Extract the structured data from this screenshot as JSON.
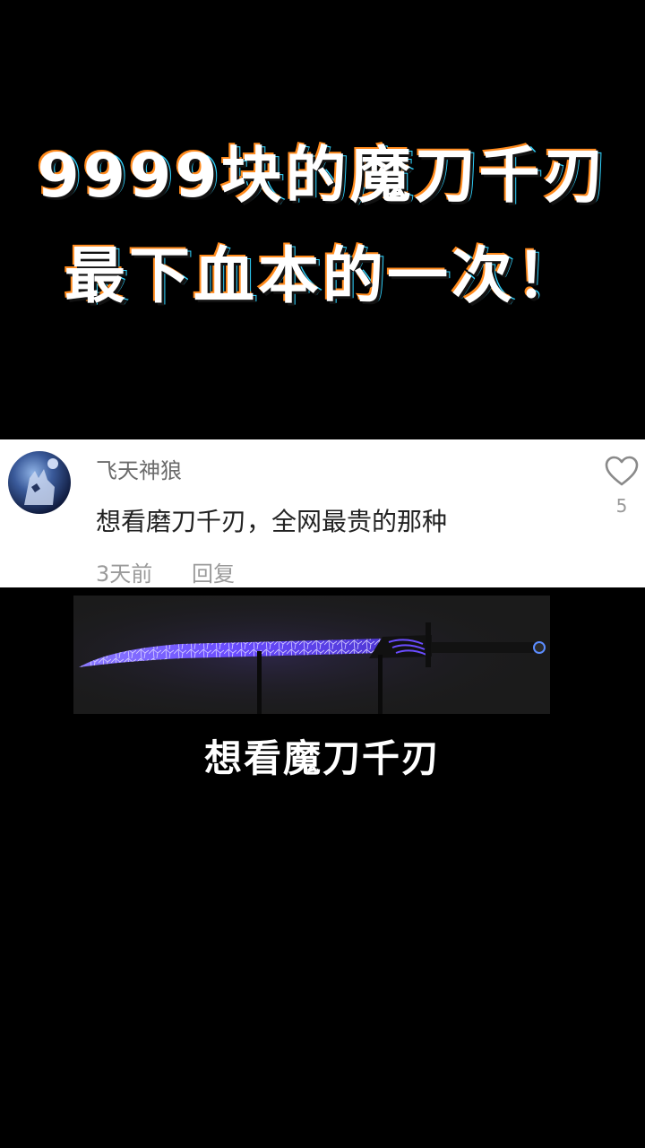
{
  "title": {
    "line1": "9999块的魔刀千刃",
    "line2": "最下血本的一次！"
  },
  "comment": {
    "username": "飞天神狼",
    "text": "想看磨刀千刃，全网最贵的那种",
    "time": "3天前",
    "reply_label": "回复",
    "like_count": "5"
  },
  "caption": "想看魔刀千刃",
  "colors": {
    "blade_glow": "#6a4cff",
    "title_outline_orange": "#ff8a1c",
    "title_outline_cyan": "#2fd3ff"
  },
  "icons": {
    "like": "heart-outline-icon",
    "avatar": "wolf-avatar"
  }
}
